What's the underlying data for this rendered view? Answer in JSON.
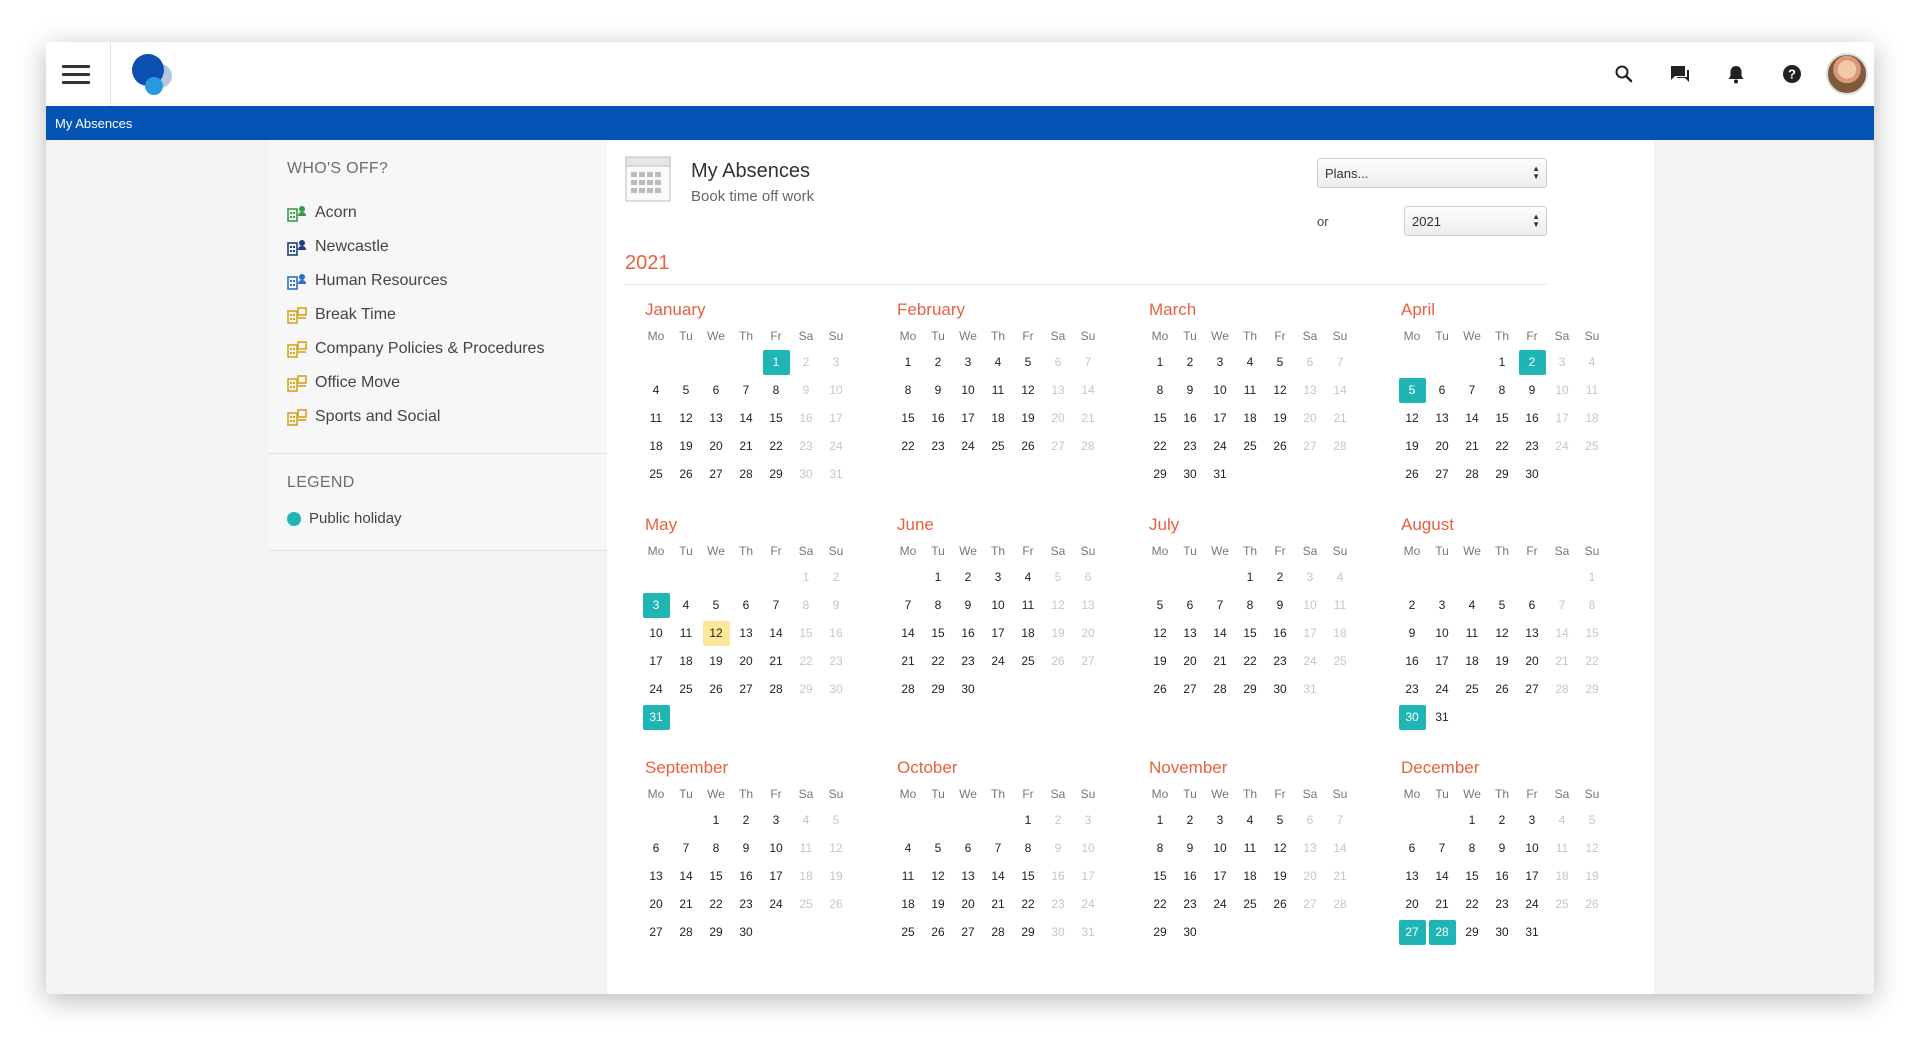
{
  "breadcrumb": "My Absences",
  "colors": {
    "brand": "#0353b4",
    "accent": "#e96040",
    "public_holiday": "#20b5b5",
    "today": "#fde89a"
  },
  "header_icons": [
    "search-icon",
    "chat-icon",
    "bell-icon",
    "help-icon"
  ],
  "sidebar": {
    "whos_off_title": "WHO'S OFF?",
    "items": [
      {
        "label": "Acorn",
        "icon": "team-icon",
        "color": "#3a9a4a"
      },
      {
        "label": "Newcastle",
        "icon": "team-icon",
        "color": "#1e3f7a"
      },
      {
        "label": "Human Resources",
        "icon": "team-icon",
        "color": "#2f6fc4"
      },
      {
        "label": "Break Time",
        "icon": "group-icon",
        "color": "#d7a21e"
      },
      {
        "label": "Company Policies & Procedures",
        "icon": "group-icon",
        "color": "#d7a21e"
      },
      {
        "label": "Office Move",
        "icon": "group-icon",
        "color": "#d7a21e"
      },
      {
        "label": "Sports and Social",
        "icon": "group-icon",
        "color": "#d7a21e"
      }
    ],
    "legend_title": "LEGEND",
    "legend": [
      {
        "label": "Public holiday"
      }
    ]
  },
  "main": {
    "title": "My Absences",
    "subtitle": "Book time off work",
    "plans_select": "Plans...",
    "or_label": "or",
    "year_select": "2021",
    "year_heading": "2021"
  },
  "calendar": {
    "year": 2021,
    "weekdays": [
      "Mo",
      "Tu",
      "We",
      "Th",
      "Fr",
      "Sa",
      "Su"
    ],
    "months": [
      {
        "name": "January",
        "holidays": [
          1
        ]
      },
      {
        "name": "February",
        "holidays": []
      },
      {
        "name": "March",
        "holidays": []
      },
      {
        "name": "April",
        "holidays": [
          2,
          5
        ]
      },
      {
        "name": "May",
        "holidays": [
          3,
          31
        ],
        "today": 12
      },
      {
        "name": "June",
        "holidays": []
      },
      {
        "name": "July",
        "holidays": []
      },
      {
        "name": "August",
        "holidays": [
          30
        ]
      },
      {
        "name": "September",
        "holidays": []
      },
      {
        "name": "October",
        "holidays": []
      },
      {
        "name": "November",
        "holidays": []
      },
      {
        "name": "December",
        "holidays": [
          27,
          28
        ]
      }
    ]
  }
}
